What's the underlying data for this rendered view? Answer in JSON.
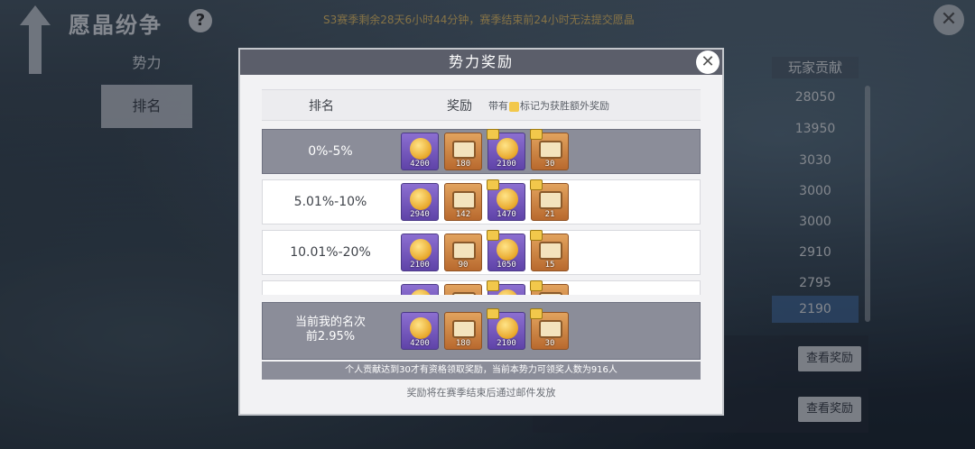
{
  "header": {
    "title": "愿晶纷争",
    "help": "?",
    "season_notice": "S3赛季剩余28天6小时44分钟，赛季结束前24小时无法提交愿晶",
    "close": "✕"
  },
  "tabs": [
    {
      "label": "势力"
    },
    {
      "label": "排名"
    }
  ],
  "background": {
    "contrib_header": "玩家贡献",
    "contributions": [
      "28050",
      "13950",
      "3030",
      "3000",
      "3000",
      "2910",
      "2795",
      "2190"
    ],
    "view_reward_label": "查看奖励"
  },
  "modal": {
    "title": "势力奖励",
    "close": "✕",
    "col_rank": "排名",
    "col_reward": "奖励",
    "col_note_prefix": "带有",
    "col_note_suffix": "标记为获胜额外奖励",
    "rows": [
      {
        "rank": "0%-5%",
        "items": [
          {
            "kind": "coin",
            "color": "purple",
            "qty": "4200",
            "bonus": false
          },
          {
            "kind": "chest",
            "color": "orange",
            "qty": "180",
            "bonus": false
          },
          {
            "kind": "coin",
            "color": "purple",
            "qty": "2100",
            "bonus": true
          },
          {
            "kind": "chest",
            "color": "orange",
            "qty": "30",
            "bonus": true
          }
        ]
      },
      {
        "rank": "5.01%-10%",
        "items": [
          {
            "kind": "coin",
            "color": "purple",
            "qty": "2940",
            "bonus": false
          },
          {
            "kind": "chest",
            "color": "orange",
            "qty": "142",
            "bonus": false
          },
          {
            "kind": "coin",
            "color": "purple",
            "qty": "1470",
            "bonus": true
          },
          {
            "kind": "chest",
            "color": "orange",
            "qty": "21",
            "bonus": true
          }
        ]
      },
      {
        "rank": "10.01%-20%",
        "items": [
          {
            "kind": "coin",
            "color": "purple",
            "qty": "2100",
            "bonus": false
          },
          {
            "kind": "chest",
            "color": "orange",
            "qty": "90",
            "bonus": false
          },
          {
            "kind": "coin",
            "color": "purple",
            "qty": "1050",
            "bonus": true
          },
          {
            "kind": "chest",
            "color": "orange",
            "qty": "15",
            "bonus": true
          }
        ]
      },
      {
        "rank": "",
        "items": [
          {
            "kind": "coin",
            "color": "purple",
            "qty": "",
            "bonus": false
          },
          {
            "kind": "chest",
            "color": "orange",
            "qty": "",
            "bonus": false
          },
          {
            "kind": "coin",
            "color": "purple",
            "qty": "",
            "bonus": true
          },
          {
            "kind": "chest",
            "color": "orange",
            "qty": "",
            "bonus": true
          }
        ]
      }
    ],
    "mine": {
      "label_line1": "当前我的名次",
      "label_line2": "前2.95%",
      "items": [
        {
          "kind": "coin",
          "color": "purple",
          "qty": "4200",
          "bonus": false
        },
        {
          "kind": "chest",
          "color": "orange",
          "qty": "180",
          "bonus": false
        },
        {
          "kind": "coin",
          "color": "purple",
          "qty": "2100",
          "bonus": true
        },
        {
          "kind": "chest",
          "color": "orange",
          "qty": "30",
          "bonus": true
        }
      ]
    },
    "footnote": "个人贡献达到30才有资格领取奖励，当前本势力可领奖人数为916人",
    "mail_note": "奖励将在赛季结束后通过邮件发放"
  }
}
